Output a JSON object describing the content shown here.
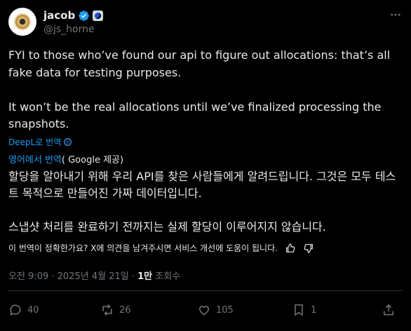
{
  "header": {
    "display_name": "jacob",
    "handle": "@js_horne",
    "icons": [
      "avatar",
      "verified-badge-icon",
      "affiliate-badge-icon",
      "more-options-icon"
    ]
  },
  "tweet": {
    "text": "FYI to those who’ve found our api to figure out allocations: that’s all fake data for testing purposes.\n\nIt won’t be the real allocations until we’ve finalized processing the snapshots."
  },
  "translation": {
    "deepl_link": "DeepL로 번역",
    "label_link": "영어에서 번역",
    "label_source": "( Google 제공)",
    "text": "할당을 알아내기 위해 우리 API를 찾은 사람들에게 알려드립니다. 그것은 모두 테스트 목적으로 만들어진 가짜 데이터입니다.\n\n스냅샷 처리를 완료하기 전까지는 실제 할당이 이루어지지 않습니다.",
    "feedback_prompt": "이 번역이 정확한가요? X에 의견을 남겨주시면 서비스 개선에 도움이 됩니다."
  },
  "meta": {
    "time": "오전 9:09",
    "separator": " · ",
    "date": "2025년 4월 21일",
    "views_count": "1만",
    "views_label": " 조회수"
  },
  "actions": {
    "replies": "40",
    "reposts": "26",
    "likes": "105",
    "bookmarks": "1"
  },
  "colors": {
    "background": "#000000",
    "text": "#e7e9ea",
    "muted": "#71767b",
    "link": "#1d9bf0",
    "divider": "#2f3336"
  }
}
